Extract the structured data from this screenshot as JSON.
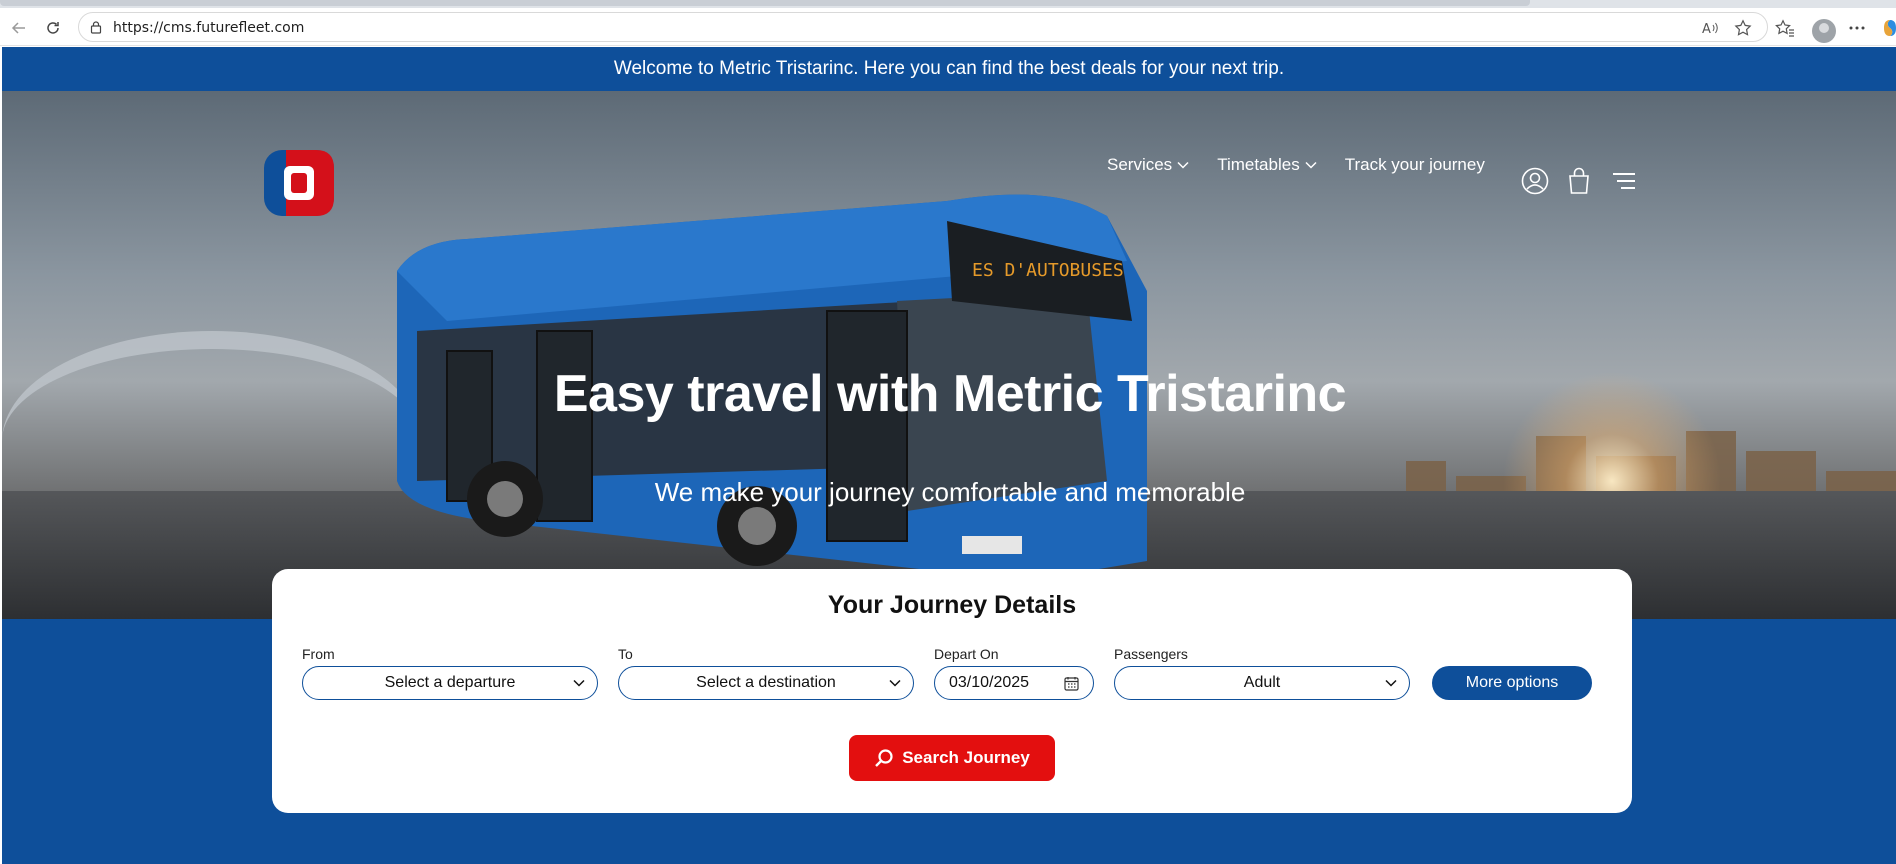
{
  "browser": {
    "url": "https://cms.futurefleet.com",
    "icons": [
      "back-icon",
      "refresh-icon",
      "lock-icon",
      "read-aloud-icon",
      "favorite-star-icon",
      "favorites-icon",
      "profile-icon",
      "more-icon",
      "copilot-icon"
    ]
  },
  "banner": {
    "text": "Welcome to Metric Tristarinc. Here you can find the best deals for your next trip."
  },
  "header": {
    "nav": [
      {
        "label": "Services",
        "has_dropdown": true
      },
      {
        "label": "Timetables",
        "has_dropdown": true
      },
      {
        "label": "Track your journey",
        "has_dropdown": false
      }
    ],
    "icons": [
      "account-icon",
      "cart-icon",
      "menu-icon"
    ]
  },
  "hero": {
    "title": "Easy travel with Metric Tristarinc",
    "subtitle": "We make your journey comfortable and memorable"
  },
  "journey": {
    "title": "Your Journey Details",
    "from_label": "From",
    "from_value": "Select a departure",
    "to_label": "To",
    "to_value": "Select a destination",
    "depart_label": "Depart On",
    "depart_value": "03/10/2025",
    "passengers_label": "Passengers",
    "passengers_value": "Adult",
    "more_options_label": "More options",
    "search_label": "Search Journey"
  },
  "colors": {
    "brand_blue": "#0e4f9a",
    "brand_red": "#e30f0f",
    "logo_red": "#d4101a"
  }
}
